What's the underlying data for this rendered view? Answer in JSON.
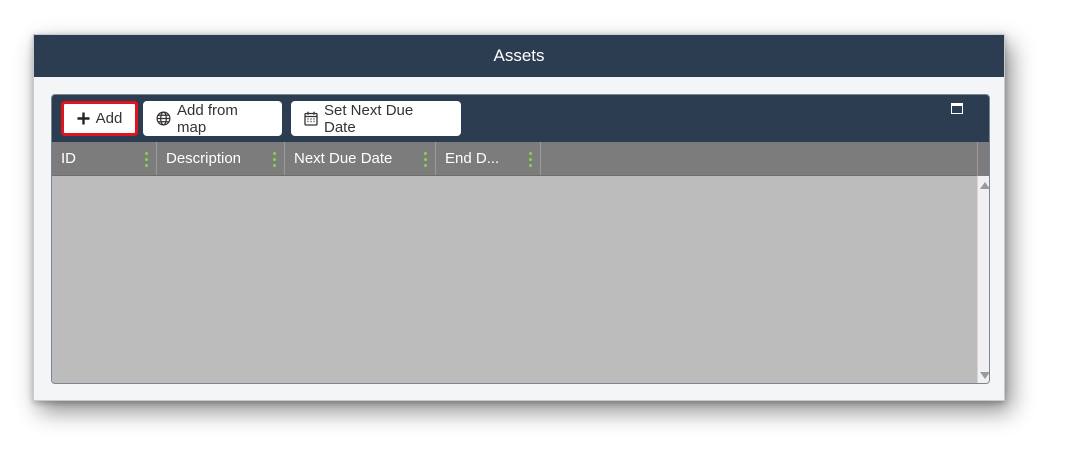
{
  "window": {
    "title": "Assets"
  },
  "toolbar": {
    "add_label": "Add",
    "add_from_map_label": "Add from map",
    "set_next_due_date_label": "Set Next Due Date"
  },
  "grid": {
    "columns": [
      "ID",
      "Description",
      "Next Due Date",
      "End D..."
    ],
    "rows": []
  },
  "icons": {
    "add": "plus-icon",
    "add_from_map": "globe-icon",
    "set_next_due_date": "calendar-icon",
    "maximize": "maximize-icon",
    "column_menu": "column-resize-handle"
  },
  "colors": {
    "title_bar": "#2c3d51",
    "header": "#7c7c7c",
    "body": "#bcbcbc",
    "highlight": "#e0141e",
    "column_handle": "#8fd04a"
  }
}
